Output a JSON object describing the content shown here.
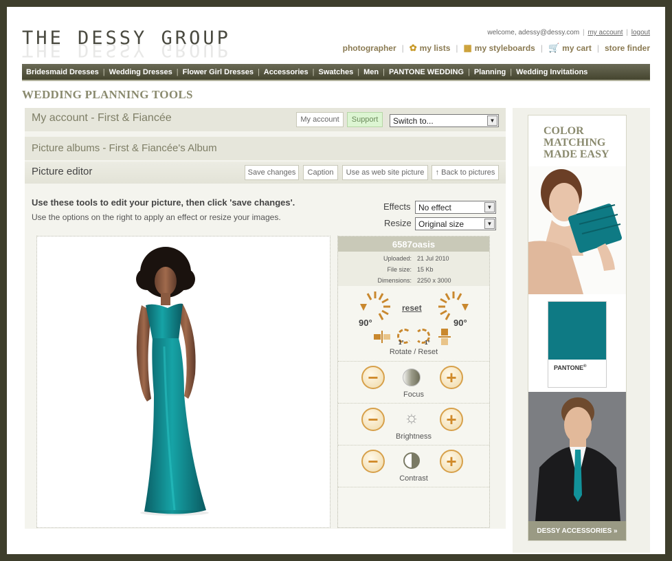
{
  "header": {
    "logo": "THE DESSY GROUP",
    "welcome": "welcome, adessy@dessy.com",
    "my_account_link": "my account",
    "logout_link": "logout",
    "nav": {
      "photographer": "photographer",
      "my_lists": "my lists",
      "my_styleboards": "my styleboards",
      "my_cart": "my cart",
      "store_finder": "store finder"
    }
  },
  "main_nav": [
    "Bridesmaid Dresses",
    "Wedding Dresses",
    "Flower Girl Dresses",
    "Accessories",
    "Swatches",
    "Men",
    "PANTONE WEDDING",
    "Planning",
    "Wedding Invitations"
  ],
  "section_title": "WEDDING PLANNING TOOLS",
  "account_bar": {
    "title": "My account - First & Fiancée",
    "my_account_btn": "My account",
    "support_btn": "Support",
    "switch_select": "Switch to..."
  },
  "album_bar": {
    "title": "Picture albums - First & Fiancée's Album"
  },
  "editor_bar": {
    "title": "Picture editor",
    "save_btn": "Save changes",
    "caption_btn": "Caption",
    "use_site_btn": "Use as web site picture",
    "back_btn": "Back to pictures"
  },
  "instructions": {
    "line1": "Use these tools to edit your picture, then click 'save changes'.",
    "line2": "Use the options on the right to apply an effect or resize your images."
  },
  "options": {
    "effects_label": "Effects",
    "effects_value": "No effect",
    "resize_label": "Resize",
    "resize_value": "Original size"
  },
  "tools": {
    "filename": "6587oasis",
    "uploaded_label": "Uploaded:",
    "uploaded_value": "21 Jul 2010",
    "filesize_label": "File size:",
    "filesize_value": "15 Kb",
    "dimensions_label": "Dimensions:",
    "dimensions_value": "2250 x 3000",
    "rotate_left_deg": "90°",
    "rotate_right_deg": "90°",
    "reset": "reset",
    "fine_left": "1°",
    "fine_right": "1°",
    "rotate_label": "Rotate / Reset",
    "focus_label": "Focus",
    "brightness_label": "Brightness",
    "contrast_label": "Contrast"
  },
  "ad": {
    "title_line1": "COLOR",
    "title_line2": "MATCHING",
    "title_line3": "MADE EASY",
    "pantone": "PANTONE",
    "footer": "DESSY ACCESSORIES »",
    "swatch_color": "#0e7a84"
  },
  "colors": {
    "nav_bg": "#55553f",
    "accent": "#8a7a52",
    "teal": "#0e7a84"
  }
}
